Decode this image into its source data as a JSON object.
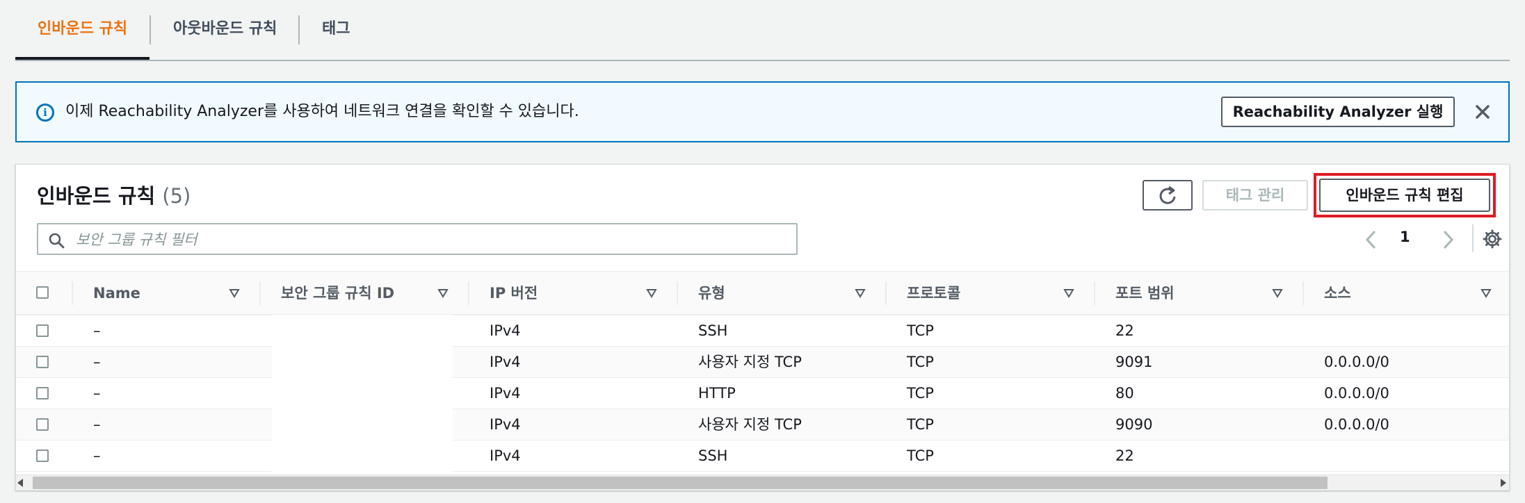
{
  "tabs": [
    {
      "label": "인바운드 규칙",
      "active": true
    },
    {
      "label": "아웃바운드 규칙",
      "active": false
    },
    {
      "label": "태그",
      "active": false
    }
  ],
  "info": {
    "message": "이제 Reachability Analyzer를 사용하여 네트워크 연결을 확인할 수 있습니다.",
    "button_label": "Reachability Analyzer 실행",
    "icon": "info-icon"
  },
  "panel": {
    "title": "인바운드 규칙",
    "count": "(5)",
    "manage_tags_label": "태그 관리",
    "edit_rules_label": "인바운드 규칙 편집",
    "search_placeholder": "보안 그룹 규칙 필터",
    "page": "1"
  },
  "table": {
    "columns": [
      "Name",
      "보안 그룹 규칙 ID",
      "IP 버전",
      "유형",
      "프로토콜",
      "포트 범위",
      "소스"
    ],
    "rows": [
      {
        "name": "–",
        "rule_id": "",
        "ip_version": "IPv4",
        "type": "SSH",
        "protocol": "TCP",
        "port_range": "22",
        "source": ""
      },
      {
        "name": "–",
        "rule_id": "",
        "ip_version": "IPv4",
        "type": "사용자 지정 TCP",
        "protocol": "TCP",
        "port_range": "9091",
        "source": "0.0.0.0/0"
      },
      {
        "name": "–",
        "rule_id": "",
        "ip_version": "IPv4",
        "type": "HTTP",
        "protocol": "TCP",
        "port_range": "80",
        "source": "0.0.0.0/0"
      },
      {
        "name": "–",
        "rule_id": "",
        "ip_version": "IPv4",
        "type": "사용자 지정 TCP",
        "protocol": "TCP",
        "port_range": "9090",
        "source": "0.0.0.0/0"
      },
      {
        "name": "–",
        "rule_id": "",
        "ip_version": "IPv4",
        "type": "SSH",
        "protocol": "TCP",
        "port_range": "22",
        "source": ""
      }
    ]
  },
  "colors": {
    "accent": "#ec7211",
    "info_border": "#0073bb",
    "info_bg": "#f1faff",
    "highlight": "#e01b24"
  }
}
